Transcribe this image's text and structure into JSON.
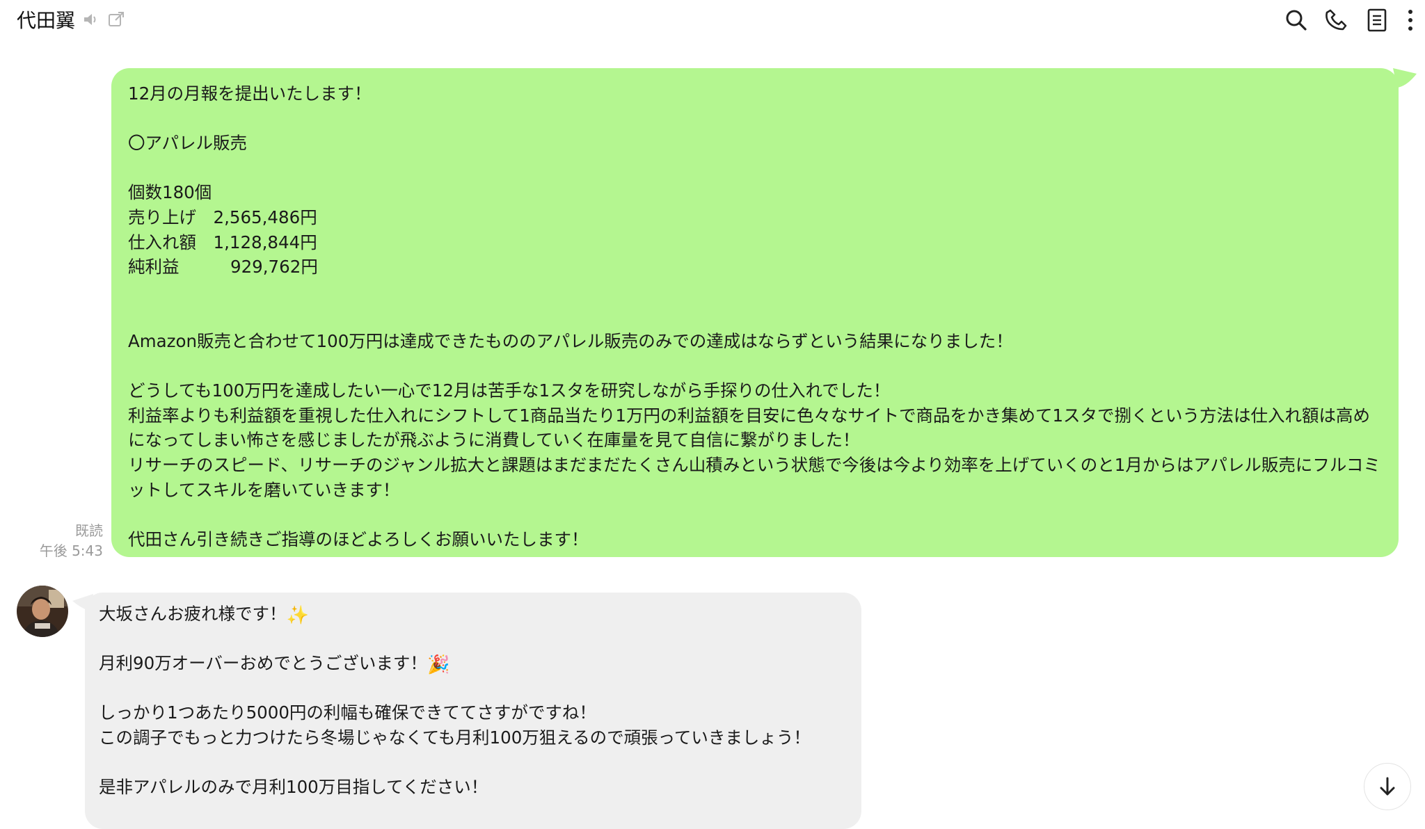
{
  "header": {
    "contact_name": "代田翼",
    "icons": [
      "speaker-icon",
      "popout-icon",
      "search-icon",
      "phone-icon",
      "notes-icon",
      "more-icon"
    ]
  },
  "outgoing": {
    "text": "12月の月報を提出いたします！\n\n〇アパレル販売\n\n個数180個\n売り上げ　2,565,486円\n仕入れ額　1,128,844円\n純利益　　　929,762円\n\n\nAmazon販売と合わせて100万円は達成できたもののアパレル販売のみでの達成はならずという結果になりました！\n\nどうしても100万円を達成したい一心で12月は苦手な1スタを研究しながら手探りの仕入れでした！\n利益率よりも利益額を重視した仕入れにシフトして1商品当たり1万円の利益額を目安に色々なサイトで商品をかき集めて1スタで捌くという方法は仕入れ額は高めになってしまい怖さを感じましたが飛ぶように消費していく在庫量を見て自信に繋がりました！\nリサーチのスピード、リサーチのジャンル拡大と課題はまだまだたくさん山積みという状態で今後は今より効率を上げていくのと1月からはアパレル販売にフルコミットしてスキルを磨いていきます！\n\n代田さん引き続きご指導のほどよろしくお願いいたします！",
    "read_label": "既読",
    "time": "午後 5:43",
    "bubble_color": "#b4f690"
  },
  "incoming": {
    "line1": "大坂さんお疲れ様です！",
    "emoji1": "✨",
    "line2": "月利90万オーバーおめでとうございます！",
    "emoji2": "🎉",
    "rest": "しっかり1つあたり5000円の利幅も確保できててさすがですね！\nこの調子でもっと力つけたら冬場じゃなくても月利100万狙えるので頑張っていきましょう！\n\n是非アパレルのみで月利100万目指してください！",
    "bubble_color": "#efefef"
  },
  "scroll_down_icon": "arrow-down-icon"
}
